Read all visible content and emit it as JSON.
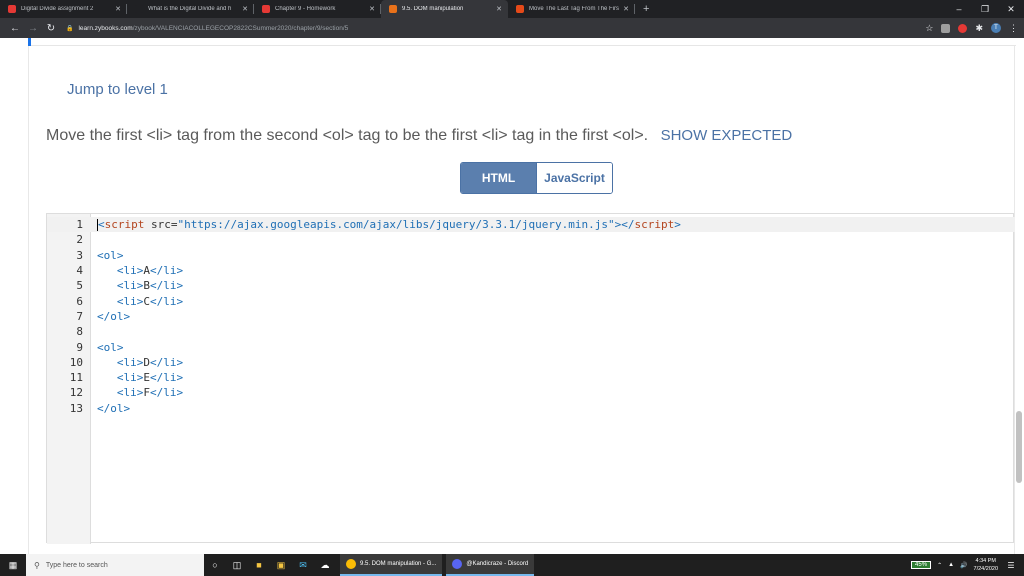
{
  "browser": {
    "tabs": [
      {
        "title": "Digital Divide assignment 2",
        "favicon": "zybooks-v-icon",
        "color": "#e53935",
        "active": false
      },
      {
        "title": "What is the Digital Divide and h",
        "favicon": "m-icon",
        "color": "#202124",
        "active": false
      },
      {
        "title": "Chapter 9 - Homework",
        "favicon": "zybooks-v-icon",
        "color": "#e53935",
        "active": false
      },
      {
        "title": "9.5. DOM manipulation",
        "favicon": "zy-icon",
        "color": "#e8711a",
        "active": true
      },
      {
        "title": "Move The Last Tag From The Firs",
        "favicon": "c-icon",
        "color": "#e64a19",
        "active": false
      }
    ],
    "new_tab": "+",
    "url_host": "learn.zybooks.com",
    "url_path": "/zybook/VALENCIACOLLEGECOP2822CSummer2020/chapter/9/section/5",
    "profile_initial": "T"
  },
  "page": {
    "jump_label": "Jump to level 1",
    "instruction": "Move the first <li> tag from the second <ol> tag to be the first <li> tag in the first <ol>.",
    "show_expected": "SHOW EXPECTED",
    "tabs": {
      "html": "HTML",
      "js": "JavaScript"
    }
  },
  "editor": {
    "lines": [
      {
        "n": "1",
        "parts": [
          [
            "tag",
            "<"
          ],
          [
            "kw",
            "script"
          ],
          [
            "attr",
            " src="
          ],
          [
            "str",
            "\"https://ajax.googleapis.com/ajax/libs/jquery/3.3.1/jquery.min.js\""
          ],
          [
            "tag",
            "></"
          ],
          [
            "kw",
            "script"
          ],
          [
            "tag",
            ">"
          ]
        ],
        "active": true
      },
      {
        "n": "2",
        "parts": []
      },
      {
        "n": "3",
        "parts": [
          [
            "tag",
            "<ol>"
          ]
        ]
      },
      {
        "n": "4",
        "parts": [
          [
            "tag",
            "   <li>"
          ],
          [
            "attr",
            "A"
          ],
          [
            "tag",
            "</li>"
          ]
        ]
      },
      {
        "n": "5",
        "parts": [
          [
            "tag",
            "   <li>"
          ],
          [
            "attr",
            "B"
          ],
          [
            "tag",
            "</li>"
          ]
        ]
      },
      {
        "n": "6",
        "parts": [
          [
            "tag",
            "   <li>"
          ],
          [
            "attr",
            "C"
          ],
          [
            "tag",
            "</li>"
          ]
        ]
      },
      {
        "n": "7",
        "parts": [
          [
            "tag",
            "</ol>"
          ]
        ]
      },
      {
        "n": "8",
        "parts": []
      },
      {
        "n": "9",
        "parts": [
          [
            "tag",
            "<ol>"
          ]
        ]
      },
      {
        "n": "10",
        "parts": [
          [
            "tag",
            "   <li>"
          ],
          [
            "attr",
            "D"
          ],
          [
            "tag",
            "</li>"
          ]
        ]
      },
      {
        "n": "11",
        "parts": [
          [
            "tag",
            "   <li>"
          ],
          [
            "attr",
            "E"
          ],
          [
            "tag",
            "</li>"
          ]
        ]
      },
      {
        "n": "12",
        "parts": [
          [
            "tag",
            "   <li>"
          ],
          [
            "attr",
            "F"
          ],
          [
            "tag",
            "</li>"
          ]
        ]
      },
      {
        "n": "13",
        "parts": [
          [
            "tag",
            "</ol>"
          ]
        ]
      }
    ]
  },
  "taskbar": {
    "search_placeholder": "Type here to search",
    "apps": [
      {
        "label": "9.5. DOM manipulation - G...",
        "icon": "chrome-icon",
        "color": "#fbbc05"
      },
      {
        "label": "@Kandicraze - Discord",
        "icon": "discord-icon",
        "color": "#5865f2"
      }
    ],
    "battery": "45%",
    "time": "4:34 PM",
    "date": "7/24/2020"
  }
}
